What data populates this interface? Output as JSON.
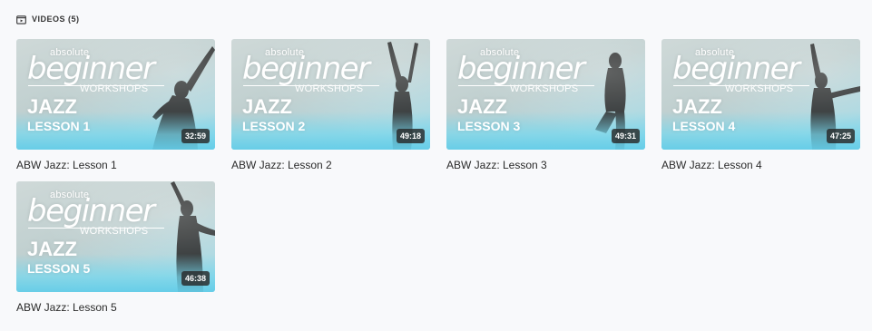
{
  "section": {
    "title": "VIDEOS (5)",
    "icon": "video-icon"
  },
  "videos": [
    {
      "title": "ABW Jazz: Lesson 1",
      "brand_top": "absolute",
      "brand_main": "beginner",
      "brand_sub": "WORKSHOPS",
      "style": "JAZZ",
      "lesson": "LESSON 1",
      "duration": "32:59"
    },
    {
      "title": "ABW Jazz: Lesson 2",
      "brand_top": "absolute",
      "brand_main": "beginner",
      "brand_sub": "WORKSHOPS",
      "style": "JAZZ",
      "lesson": "LESSON 2",
      "duration": "49:18"
    },
    {
      "title": "ABW Jazz: Lesson 3",
      "brand_top": "absolute",
      "brand_main": "beginner",
      "brand_sub": "WORKSHOPS",
      "style": "JAZZ",
      "lesson": "LESSON 3",
      "duration": "49:31"
    },
    {
      "title": "ABW Jazz: Lesson 4",
      "brand_top": "absolute",
      "brand_main": "beginner",
      "brand_sub": "WORKSHOPS",
      "style": "JAZZ",
      "lesson": "LESSON 4",
      "duration": "47:25"
    },
    {
      "title": "ABW Jazz: Lesson 5",
      "brand_top": "absolute",
      "brand_main": "beginner",
      "brand_sub": "WORKSHOPS",
      "style": "JAZZ",
      "lesson": "LESSON 5",
      "duration": "46:38"
    }
  ]
}
